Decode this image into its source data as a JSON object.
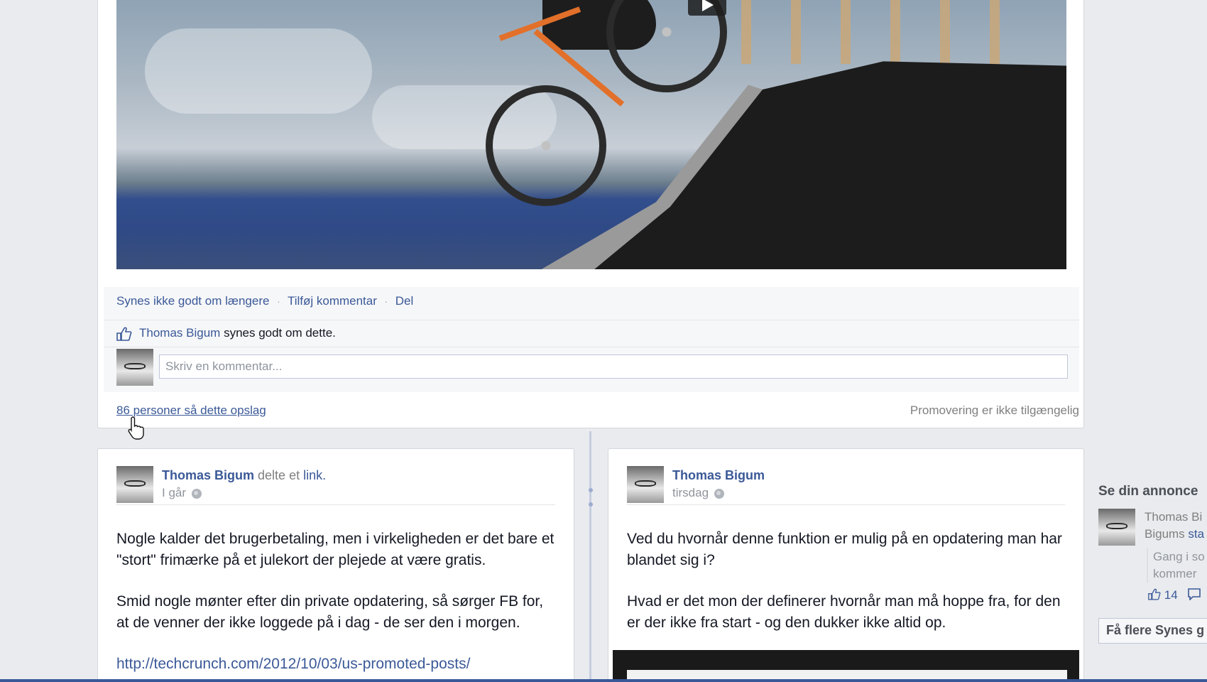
{
  "main_post": {
    "actions": {
      "unlike": "Synes ikke godt om længere",
      "comment": "Tilføj kommentar",
      "share": "Del",
      "separator": "·"
    },
    "likes": {
      "name": "Thomas Bigum",
      "suffix": "synes godt om dette."
    },
    "comment_placeholder": "Skriv en kommentar...",
    "seen_by": "86 personer så dette opslag",
    "promotion_status": "Promovering er ikke tilgængelig"
  },
  "posts": [
    {
      "author": "Thomas Bigum",
      "action_prefix": "delte et",
      "action_link": "link.",
      "time": "I går",
      "paragraphs": [
        "Nogle kalder det brugerbetaling, men i virkeligheden er det bare et \"stort\" frimærke på et julekort der plejede at være gratis.",
        "Smid nogle mønter efter din private opdatering, så sørger FB for, at de venner der ikke loggede på i dag - de ser den i morgen."
      ],
      "url": "http://techcrunch.com/2012/10/03/us-promoted-posts/"
    },
    {
      "author": "Thomas Bigum",
      "time": "tirsdag",
      "paragraphs": [
        "Ved du hvornår denne funktion er mulig på en opdatering man har blandet sig i?",
        "Hvad er det mon der definerer hvornår man må hoppe fra, for den er der ikke fra start - og den dukker ikke altid op."
      ]
    }
  ],
  "sidebar": {
    "title": "Se din annonce",
    "ad_name": "Thomas Bi",
    "ad_sub_prefix": "Bigums",
    "ad_sub_link": "sta",
    "ad_quote_line1": "Gang i so",
    "ad_quote_line2": "kommer",
    "ad_likes": "14",
    "more_button": "Få flere Synes g"
  },
  "icons": {
    "like": "thumbs-up-icon",
    "privacy": "globe-icon",
    "play": "play-icon",
    "cursor": "hand-cursor-icon"
  },
  "colors": {
    "link": "#3b5998",
    "background": "#e9ebee",
    "muted": "#90949c"
  }
}
